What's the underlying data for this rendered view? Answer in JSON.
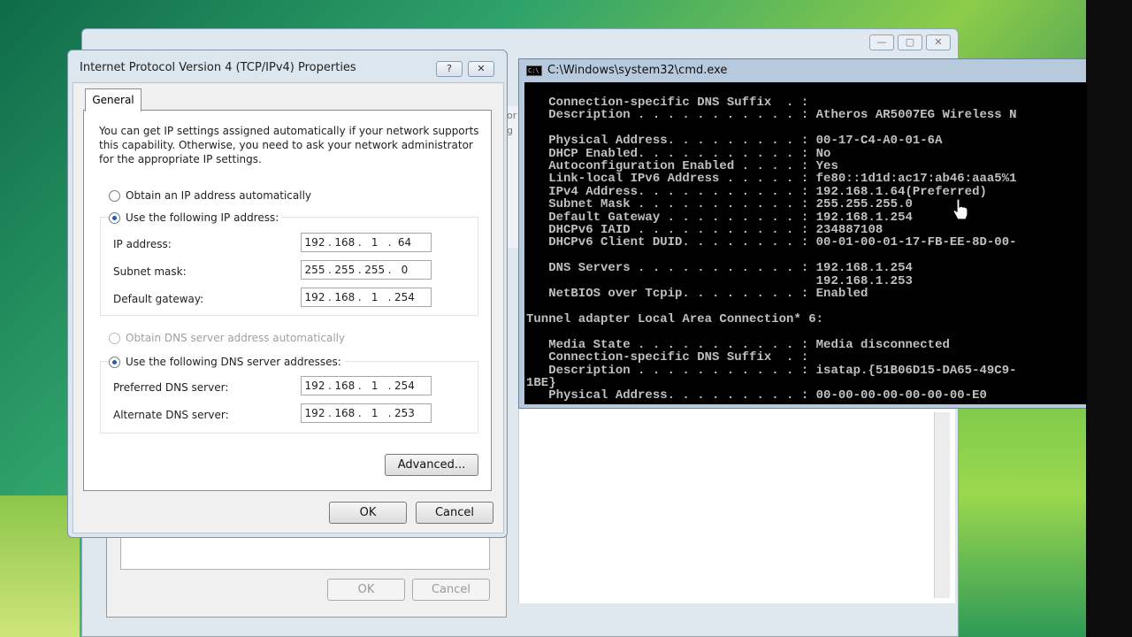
{
  "ipv4_dialog": {
    "title": "Internet Protocol Version 4 (TCP/IPv4) Properties",
    "help_glyph": "?",
    "close_glyph": "✕",
    "tab_general": "General",
    "intro": "You can get IP settings assigned automatically if your network supports this capability. Otherwise, you need to ask your network administrator for the appropriate IP settings.",
    "obtain_ip_auto": "Obtain an IP address automatically",
    "use_following_ip": "Use the following IP address:",
    "ip_label": "IP address:",
    "ip": [
      "192",
      "168",
      "1",
      "64"
    ],
    "subnet_label": "Subnet mask:",
    "subnet": [
      "255",
      "255",
      "255",
      "0"
    ],
    "gateway_label": "Default gateway:",
    "gateway": [
      "192",
      "168",
      "1",
      "254"
    ],
    "obtain_dns_auto": "Obtain DNS server address automatically",
    "use_following_dns": "Use the following DNS server addresses:",
    "pref_dns_label": "Preferred DNS server:",
    "pref_dns": [
      "192",
      "168",
      "1",
      "254"
    ],
    "alt_dns_label": "Alternate DNS server:",
    "alt_dns": [
      "192",
      "168",
      "1",
      "253"
    ],
    "advanced": "Advanced...",
    "ok": "OK",
    "cancel": "Cancel"
  },
  "background_window": {
    "ok": "OK",
    "cancel": "Cancel",
    "side_text_1": "or",
    "side_text_2": "g"
  },
  "cmd": {
    "title": "C:\\Windows\\system32\\cmd.exe",
    "icon_text": "C:\\",
    "lines": [
      "   Connection-specific DNS Suffix  . :",
      "   Description . . . . . . . . . . . : Atheros AR5007EG Wireless N",
      "",
      "   Physical Address. . . . . . . . . : 00-17-C4-A0-01-6A",
      "   DHCP Enabled. . . . . . . . . . . : No",
      "   Autoconfiguration Enabled . . . . : Yes",
      "   Link-local IPv6 Address . . . . . : fe80::1d1d:ac17:ab46:aaa5%1",
      "   IPv4 Address. . . . . . . . . . . : 192.168.1.64(Preferred)",
      "   Subnet Mask . . . . . . . . . . . : 255.255.255.0",
      "   Default Gateway . . . . . . . . . : 192.168.1.254",
      "   DHCPv6 IAID . . . . . . . . . . . : 234887108",
      "   DHCPv6 Client DUID. . . . . . . . : 00-01-00-01-17-FB-EE-8D-00-",
      "",
      "   DNS Servers . . . . . . . . . . . : 192.168.1.254",
      "                                       192.168.1.253",
      "   NetBIOS over Tcpip. . . . . . . . : Enabled",
      "",
      "Tunnel adapter Local Area Connection* 6:",
      "",
      "   Media State . . . . . . . . . . . : Media disconnected",
      "   Connection-specific DNS Suffix  . :",
      "   Description . . . . . . . . . . . : isatap.{51B06D15-DA65-49C9-",
      "1BE}",
      "   Physical Address. . . . . . . . . : 00-00-00-00-00-00-00-E0"
    ]
  }
}
